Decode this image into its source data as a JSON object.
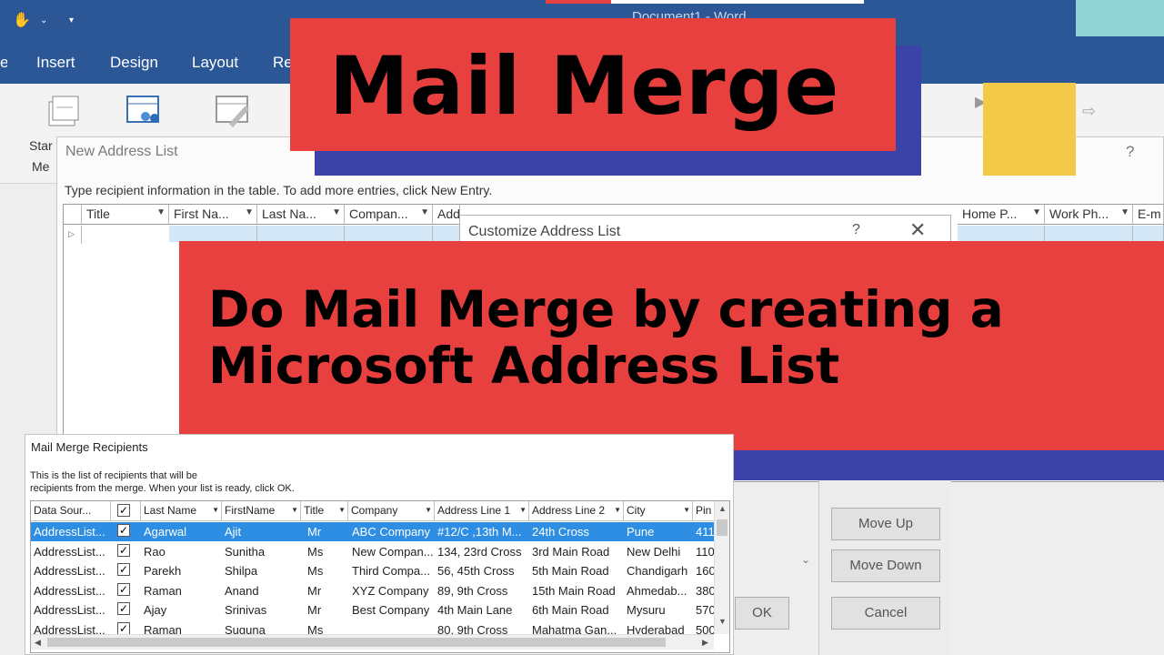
{
  "word": {
    "doc_title": "Document1 - Word",
    "tabs": [
      "Insert",
      "Design",
      "Layout",
      "Re"
    ],
    "ribbon_labels": [
      "Star",
      "Me"
    ]
  },
  "new_address_list": {
    "title": "New Address List",
    "help": "?",
    "instructions": "Type recipient information in the table.  To add more entries, click New Entry.",
    "columns": [
      "Title",
      "First Na...",
      "Last Na...",
      "Compan...",
      "Addres",
      "Home P...",
      "Work Ph...",
      "E-m"
    ],
    "row_marker": "▷",
    "buttons": {
      "move_up": "Move Up",
      "move_down": "Move Down",
      "ok": "OK",
      "cancel": "Cancel"
    }
  },
  "customize_address_list": {
    "title": "Customize Address List",
    "help": "?",
    "close": "✕"
  },
  "banner": {
    "title": "Mail Merge",
    "subtitle": "Do Mail Merge by creating a Microsoft Address List"
  },
  "mail_merge_recipients": {
    "title": "Mail Merge Recipients",
    "instructions_line1": "This is the list of recipients that will be",
    "instructions_line2": "recipients from the merge.  When your list is ready, click OK.",
    "columns": [
      "Data Sour...",
      "",
      "Last Name",
      "FirstName",
      "Title",
      "Company",
      "Address Line 1",
      "Address Line 2",
      "City",
      "Pin"
    ],
    "rows": [
      {
        "source": "AddressList...",
        "checked": true,
        "last": "Agarwal",
        "first": "Ajit",
        "title": "Mr",
        "company": "ABC Company",
        "addr1": "#12/C ,13th M...",
        "addr2": "24th Cross",
        "city": "Pune",
        "pin": "411",
        "selected": true
      },
      {
        "source": "AddressList...",
        "checked": true,
        "last": "Rao",
        "first": "Sunitha",
        "title": "Ms",
        "company": "New Compan...",
        "addr1": "134, 23rd Cross",
        "addr2": "3rd Main Road",
        "city": "New Delhi",
        "pin": "110",
        "selected": false
      },
      {
        "source": "AddressList...",
        "checked": true,
        "last": "Parekh",
        "first": "Shilpa",
        "title": "Ms",
        "company": "Third Compa...",
        "addr1": "56, 45th Cross",
        "addr2": "5th  Main Road",
        "city": "Chandigarh",
        "pin": "160",
        "selected": false
      },
      {
        "source": "AddressList...",
        "checked": true,
        "last": "Raman",
        "first": "Anand",
        "title": "Mr",
        "company": "XYZ Company",
        "addr1": "89, 9th Cross",
        "addr2": "15th Main Road",
        "city": "Ahmedab...",
        "pin": "380",
        "selected": false
      },
      {
        "source": "AddressList...",
        "checked": true,
        "last": "Ajay",
        "first": "Srinivas",
        "title": "Mr",
        "company": "Best Company",
        "addr1": "4th Main Lane",
        "addr2": "6th  Main Road",
        "city": "Mysuru",
        "pin": "570",
        "selected": false
      },
      {
        "source": "AddressList...",
        "checked": true,
        "last": "Raman",
        "first": "Suguna",
        "title": "Ms",
        "company": "",
        "addr1": "80, 9th Cross",
        "addr2": "Mahatma Gan...",
        "city": "Hyderabad",
        "pin": "500",
        "selected": false
      }
    ]
  },
  "colors": {
    "word_blue": "#2b5797",
    "banner_red": "#e8403f",
    "banner_shadow_blue": "#3c43a8",
    "selection_blue": "#2d8ee3",
    "accent_yellow": "#f3c94a",
    "accent_teal": "#92d3d4"
  }
}
